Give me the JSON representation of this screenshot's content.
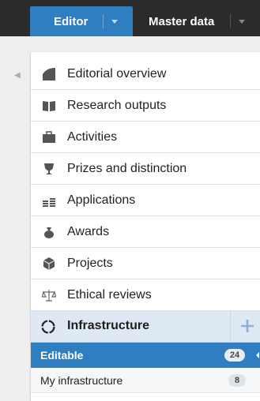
{
  "topbar": {
    "tabs": [
      {
        "label": "Editor",
        "active": true
      },
      {
        "label": "Master data",
        "active": false
      }
    ]
  },
  "menu": {
    "items": [
      {
        "label": "Editorial overview",
        "icon": "editorial-overview-icon"
      },
      {
        "label": "Research outputs",
        "icon": "book-icon"
      },
      {
        "label": "Activities",
        "icon": "briefcase-icon"
      },
      {
        "label": "Prizes and distinction",
        "icon": "trophy-icon"
      },
      {
        "label": "Applications",
        "icon": "coins-icon"
      },
      {
        "label": "Awards",
        "icon": "money-bag-icon"
      },
      {
        "label": "Projects",
        "icon": "cube-icon"
      },
      {
        "label": "Ethical reviews",
        "icon": "scales-icon"
      }
    ],
    "infrastructure": {
      "label": "Infrastructure",
      "icon": "infrastructure-icon",
      "add_icon": "plus-icon",
      "sub_items": [
        {
          "label": "Editable",
          "count": "24",
          "active": true
        },
        {
          "label": "My infrastructure",
          "count": "8",
          "active": false
        }
      ]
    }
  },
  "colors": {
    "accent": "#2f7ec1",
    "topbar": "#2b2b2b",
    "infra_bg": "#dfe9f3"
  }
}
